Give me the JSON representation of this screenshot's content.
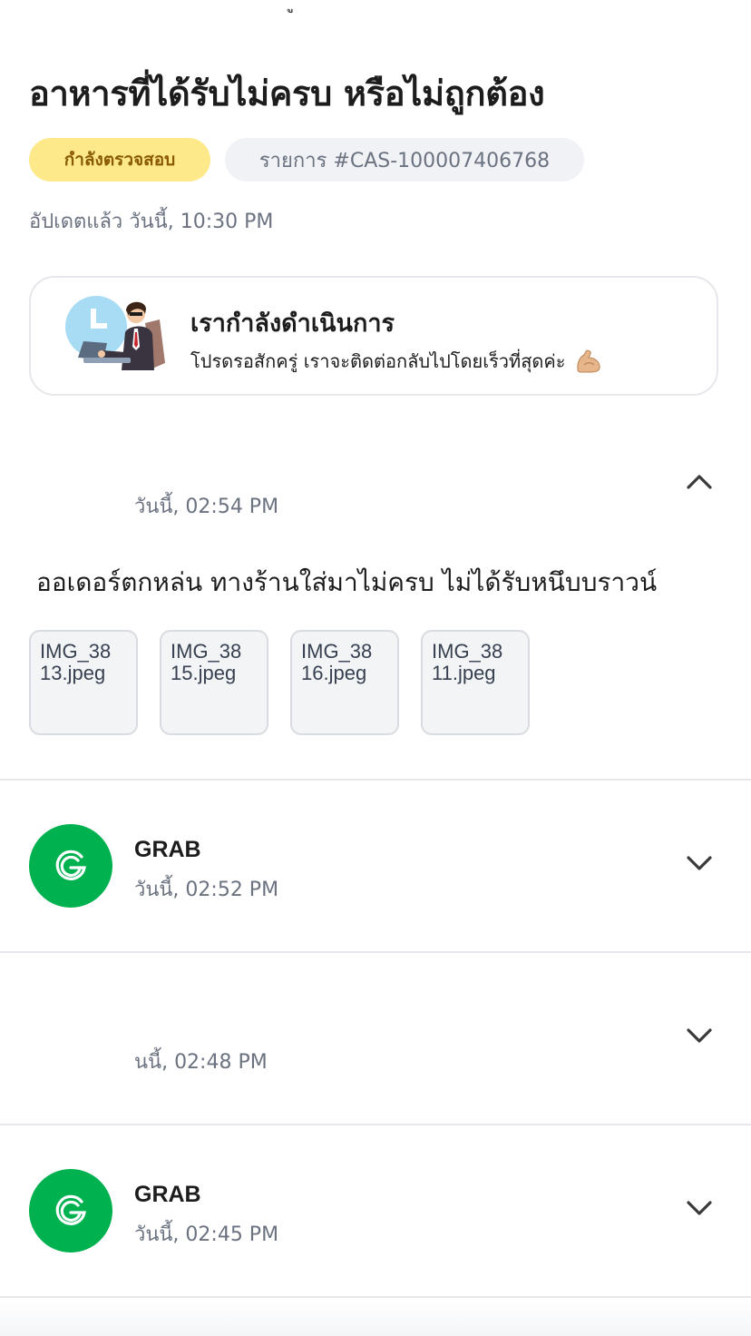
{
  "header": {
    "top_sliver": "ู",
    "title": "อาหารที่ได้รับไม่ครบ หรือไม่ถูกต้อง",
    "status_badge": "กำลังตรวจสอบ",
    "case_ref": "รายการ #CAS-100007406768",
    "updated": "อัปเดตแล้ว วันนี้, 10:30 PM"
  },
  "progress_card": {
    "title": "เรากำลังดำเนินการ",
    "subtitle": "โปรดรอสักครู่ เราจะติดต่อกลับไปโดยเร็วที่สุดค่ะ"
  },
  "timeline": [
    {
      "time": "วันนี้, 02:54 PM",
      "message": "ออเดอร์ตกหล่น ทางร้านใส่มาไม่ครบ ไม่ได้รับหนึบบราวน์",
      "attachments": [
        "IMG_3813.jpeg",
        "IMG_3815.jpeg",
        "IMG_3816.jpeg",
        "IMG_3811.jpeg"
      ],
      "attachment_display": [
        "IMG_38\n13.jpeg",
        "IMG_38\n15.jpeg",
        "IMG_38\n16.jpeg",
        "IMG_38\n11.jpeg"
      ],
      "expanded": true
    },
    {
      "sender": "GRAB",
      "time": "วันนี้, 02:52 PM",
      "expanded": false
    },
    {
      "time": "นนี้, 02:48 PM",
      "expanded": false
    },
    {
      "sender": "GRAB",
      "time": "วันนี้, 02:45 PM",
      "expanded": false
    }
  ],
  "colors": {
    "status_badge_bg": "#fde88a",
    "status_badge_text": "#8a5a00",
    "grab_green": "#00b14f",
    "muted_text": "#6b7280",
    "divider": "#e5e7eb"
  },
  "icons": {
    "illustration": "agent-at-laptop-illustration",
    "card_emoji": "flexed-biceps-icon",
    "collapse": "chevron-up-icon",
    "expand": "chevron-down-icon",
    "grab_logo": "grab-logo-icon"
  }
}
